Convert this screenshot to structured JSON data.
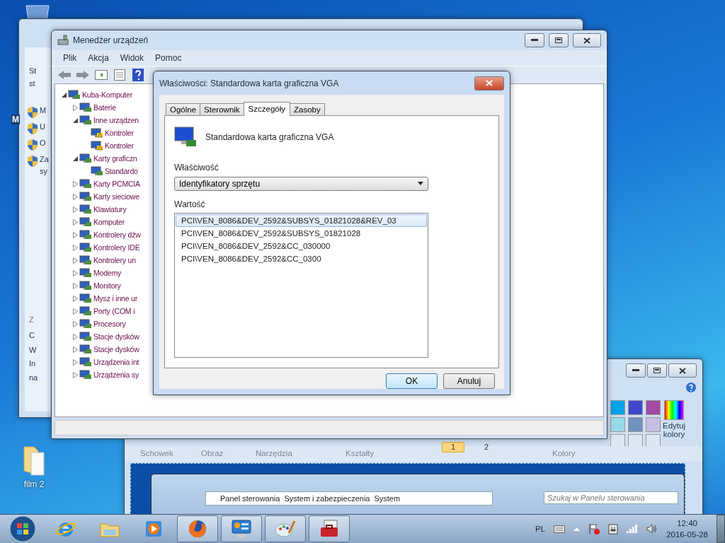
{
  "desktop": {
    "label_fragment": "M",
    "icons": [
      {
        "label": "film 2"
      }
    ]
  },
  "back_window": {
    "intro": [
      "St",
      "st"
    ],
    "links": [
      "M",
      "U",
      "O",
      "Za",
      "sy"
    ],
    "see_also_heading": "Z",
    "see_also": [
      "C",
      "W",
      "In",
      "na"
    ]
  },
  "device_manager": {
    "title": "Menedżer urządzeń",
    "menu": [
      "Plik",
      "Akcja",
      "Widok",
      "Pomoc"
    ],
    "tree": [
      {
        "label": "Kuba-Komputer",
        "expanded": true,
        "warning": false,
        "children": [
          {
            "label": "Baterie",
            "expanded": false,
            "warning": false
          },
          {
            "label": "Inne urządzen",
            "expanded": true,
            "warning": false,
            "children": [
              {
                "label": "Kontroler",
                "warning": true
              },
              {
                "label": "Kontroler",
                "warning": true
              }
            ]
          },
          {
            "label": "Karty graficzn",
            "expanded": true,
            "warning": false,
            "children": [
              {
                "label": "Standardo",
                "warning": false
              }
            ]
          },
          {
            "label": "Karty PCMCIA",
            "expanded": false,
            "warning": false
          },
          {
            "label": "Karty sieciowe",
            "expanded": false,
            "warning": false
          },
          {
            "label": "Klawiatury",
            "expanded": false,
            "warning": false
          },
          {
            "label": "Komputer",
            "expanded": false,
            "warning": false
          },
          {
            "label": "Kontrolery dźw",
            "expanded": false,
            "warning": false
          },
          {
            "label": "Kontrolery IDE",
            "expanded": false,
            "warning": false
          },
          {
            "label": "Kontrolery un",
            "expanded": false,
            "warning": false
          },
          {
            "label": "Modemy",
            "expanded": false,
            "warning": false
          },
          {
            "label": "Monitory",
            "expanded": false,
            "warning": false
          },
          {
            "label": "Mysz i inne ur",
            "expanded": false,
            "warning": false
          },
          {
            "label": "Porty (COM i",
            "expanded": false,
            "warning": false
          },
          {
            "label": "Procesory",
            "expanded": false,
            "warning": false
          },
          {
            "label": "Stacje dysków",
            "expanded": false,
            "warning": false
          },
          {
            "label": "Stacje dysków",
            "expanded": false,
            "warning": false
          },
          {
            "label": "Urządzenia int",
            "expanded": false,
            "warning": false
          },
          {
            "label": "Urządzenia sy",
            "expanded": false,
            "warning": false
          }
        ]
      }
    ]
  },
  "dialog": {
    "title": "Właściwości: Standardowa karta graficzna VGA",
    "tabs": [
      {
        "label": "Ogólne",
        "selected": false
      },
      {
        "label": "Sterownik",
        "selected": false
      },
      {
        "label": "Szczegóły",
        "selected": true
      },
      {
        "label": "Zasoby",
        "selected": false
      }
    ],
    "device_name": "Standardowa karta graficzna VGA",
    "property_label": "Właściwość",
    "property_value": "Identyfikatory sprzętu",
    "value_label": "Wartość",
    "values": [
      {
        "text": "PCI\\VEN_8086&DEV_2592&SUBSYS_01821028&REV_03",
        "selected": true
      },
      {
        "text": "PCI\\VEN_8086&DEV_2592&SUBSYS_01821028",
        "selected": false
      },
      {
        "text": "PCI\\VEN_8086&DEV_2592&CC_030000",
        "selected": false
      },
      {
        "text": "PCI\\VEN_8086&DEV_2592&CC_0300",
        "selected": false
      }
    ],
    "buttons": [
      {
        "label": "OK",
        "default": true
      },
      {
        "label": "Anuluj",
        "default": false
      }
    ]
  },
  "paint": {
    "groups": [
      "Schowek",
      "Obraz",
      "Narzędzia",
      "Kształty",
      "Kolory"
    ],
    "sizes": [
      {
        "label": "1",
        "selected": true
      },
      {
        "label": "2",
        "selected": false
      }
    ],
    "edit_colors": "Edytuj kolory",
    "nested_screenshot": {
      "breadcrumb": [
        "Panel sterowania",
        "System i zabezpieczenia",
        "System"
      ],
      "search_placeholder": "Szukaj w Panelu sterowania"
    }
  },
  "taskbar": {
    "apps": [
      {
        "kind": "browser",
        "active": false
      },
      {
        "kind": "folder",
        "active": false
      },
      {
        "kind": "media",
        "active": false
      },
      {
        "kind": "firefox",
        "active": true
      },
      {
        "kind": "panel",
        "active": true
      },
      {
        "kind": "paint",
        "active": true
      },
      {
        "kind": "toolbox",
        "active": true
      }
    ],
    "language": "PL",
    "time": "12:40",
    "date": "2016-05-28"
  }
}
